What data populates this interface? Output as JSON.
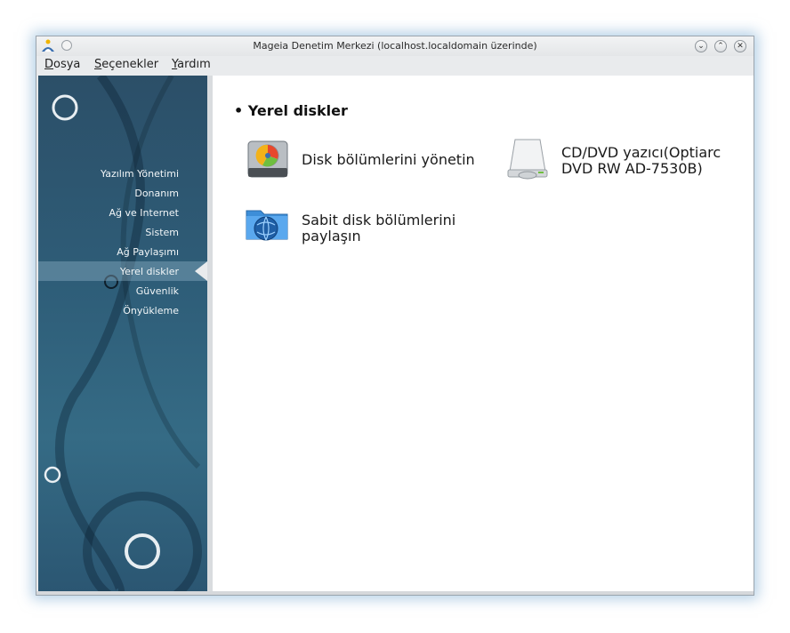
{
  "window": {
    "title": "Mageia Denetim Merkezi  (localhost.localdomain üzerinde)",
    "app_icon": "mageia-logo-icon",
    "buttons": [
      "minimize-icon",
      "maximize-icon",
      "close-icon"
    ]
  },
  "menubar": {
    "items": [
      {
        "label": "Dosya",
        "mnemonic": "D"
      },
      {
        "label": "Seçenekler",
        "mnemonic": "S"
      },
      {
        "label": "Yardım",
        "mnemonic": "Y"
      }
    ]
  },
  "sidebar": {
    "items": [
      {
        "label": "Yazılım Yönetimi"
      },
      {
        "label": "Donanım"
      },
      {
        "label": "Ağ ve Internet"
      },
      {
        "label": "Sistem"
      },
      {
        "label": "Ağ Paylaşımı"
      },
      {
        "label": "Yerel diskler"
      },
      {
        "label": "Güvenlik"
      },
      {
        "label": "Önyükleme"
      }
    ],
    "selected": "Yerel diskler"
  },
  "content": {
    "section_title": "Yerel diskler",
    "entries": [
      {
        "label_line1": "Disk bölümlerini yönetin",
        "label_line2": "",
        "icon": "hard-disk-partition-icon"
      },
      {
        "label_line1": "CD/DVD yazıcı(Optiarc",
        "label_line2": "DVD RW AD-7530B)",
        "icon": "optical-drive-icon"
      },
      {
        "label_line1": "Sabit disk bölümlerini",
        "label_line2": "paylaşın",
        "icon": "network-folder-icon"
      }
    ]
  },
  "colors": {
    "sidebar_bg": "#2e5d78",
    "selection": "#a0c3d7",
    "accent_glow": "#78aad2"
  }
}
